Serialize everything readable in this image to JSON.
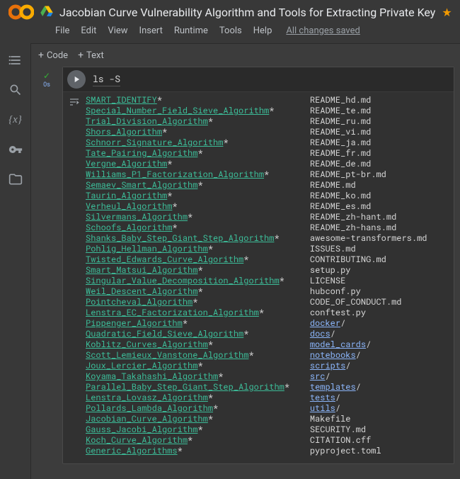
{
  "header": {
    "title": "Jacobian Curve Vulnerability Algorithm and Tools for Extracting Private Key",
    "starred": true
  },
  "menu": {
    "file": "File",
    "edit": "Edit",
    "view": "View",
    "insert": "Insert",
    "runtime": "Runtime",
    "tools": "Tools",
    "help": "Help",
    "saved": "All changes saved"
  },
  "toolbar": {
    "code": "Code",
    "text": "Text"
  },
  "gutter": {
    "time": "0s"
  },
  "cell": {
    "code": "ls -S"
  },
  "output": {
    "pad": 44,
    "col1": [
      {
        "name": "SMART_IDENTIFY",
        "exec": true
      },
      {
        "name": "Special_Number_Field_Sieve_Algorithm",
        "exec": true
      },
      {
        "name": "Trial_Division_Algorithm",
        "exec": true
      },
      {
        "name": "Shors_Algorithm",
        "exec": true
      },
      {
        "name": "Schnorr_Signature_Algorithm",
        "exec": true
      },
      {
        "name": "Tate_Pairing_Algorithm",
        "exec": true
      },
      {
        "name": "Vergne_Algorithm",
        "exec": true
      },
      {
        "name": "Williams_P1_Factorization_Algorithm",
        "exec": true
      },
      {
        "name": "Semaev_Smart_Algorithm",
        "exec": true
      },
      {
        "name": "Taurin_Algorithm",
        "exec": true
      },
      {
        "name": "Verheul_Algorithm",
        "exec": true
      },
      {
        "name": "Silvermans_Algorithm",
        "exec": true
      },
      {
        "name": "Schoofs_Algorithm",
        "exec": true
      },
      {
        "name": "Shanks_Baby_Step_Giant_Step_Algorithm",
        "exec": true
      },
      {
        "name": "Pohlig_Hellman_Algorithm",
        "exec": true
      },
      {
        "name": "Twisted_Edwards_Curve_Algorithm",
        "exec": true
      },
      {
        "name": "Smart_Matsui_Algorithm",
        "exec": true
      },
      {
        "name": "Singular_Value_Decomposition_Algorithm",
        "exec": true
      },
      {
        "name": "Weil_Descent_Algorithm",
        "exec": true
      },
      {
        "name": "Pointcheval_Algorithm",
        "exec": true
      },
      {
        "name": "Lenstra_EC_Factorization_Algorithm",
        "exec": true
      },
      {
        "name": "Pippenger_Algorithm",
        "exec": true
      },
      {
        "name": "Quadratic_Field_Sieve_Algorithm",
        "exec": true
      },
      {
        "name": "Koblitz_Curves_Algorithm",
        "exec": true
      },
      {
        "name": "Scott_Lemieux_Vanstone_Algorithm",
        "exec": true
      },
      {
        "name": "Joux_Lercier_Algorithm",
        "exec": true
      },
      {
        "name": "Koyama_Takahashi_Algorithm",
        "exec": true
      },
      {
        "name": "Parallel_Baby_Step_Giant_Step_Algorithm",
        "exec": true
      },
      {
        "name": "Lenstra_Lovasz_Algorithm",
        "exec": true
      },
      {
        "name": "Pollards_Lambda_Algorithm",
        "exec": true
      },
      {
        "name": "Jacobian_Curve_Algorithm",
        "exec": true
      },
      {
        "name": "Gauss_Jacobi_Algorithm",
        "exec": true
      },
      {
        "name": "Koch_Curve_Algorithm",
        "exec": true
      },
      {
        "name": "Generic_Algorithms",
        "exec": true
      }
    ],
    "col2": [
      {
        "name": "README_hd.md"
      },
      {
        "name": "README_te.md"
      },
      {
        "name": "README_ru.md"
      },
      {
        "name": "README_vi.md"
      },
      {
        "name": "README_ja.md"
      },
      {
        "name": "README_fr.md"
      },
      {
        "name": "README_de.md"
      },
      {
        "name": "README_pt-br.md"
      },
      {
        "name": "README.md"
      },
      {
        "name": "README_ko.md"
      },
      {
        "name": "README_es.md"
      },
      {
        "name": "README_zh-hant.md"
      },
      {
        "name": "README_zh-hans.md"
      },
      {
        "name": "awesome-transformers.md"
      },
      {
        "name": "ISSUES.md"
      },
      {
        "name": "CONTRIBUTING.md"
      },
      {
        "name": "setup.py"
      },
      {
        "name": "LICENSE"
      },
      {
        "name": "hubconf.py"
      },
      {
        "name": "CODE_OF_CONDUCT.md"
      },
      {
        "name": "conftest.py"
      },
      {
        "name": "docker",
        "dir": true
      },
      {
        "name": "docs",
        "dir": true
      },
      {
        "name": "model_cards",
        "dir": true
      },
      {
        "name": "notebooks",
        "dir": true
      },
      {
        "name": "scripts",
        "dir": true
      },
      {
        "name": "src",
        "dir": true
      },
      {
        "name": "templates",
        "dir": true
      },
      {
        "name": "tests",
        "dir": true
      },
      {
        "name": "utils",
        "dir": true
      },
      {
        "name": "Makefile"
      },
      {
        "name": "SECURITY.md"
      },
      {
        "name": "CITATION.cff"
      },
      {
        "name": "pyproject.toml"
      }
    ]
  }
}
